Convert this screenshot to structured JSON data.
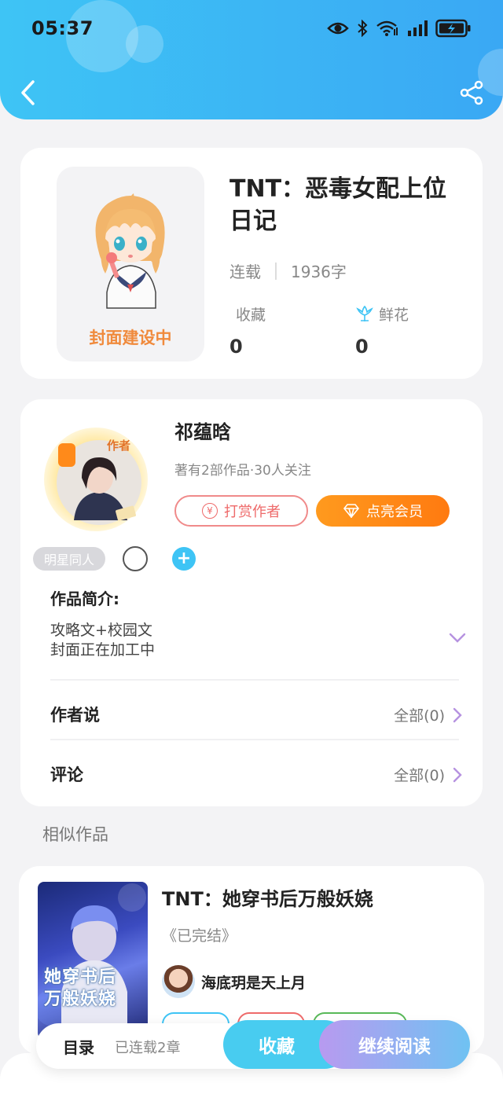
{
  "status_bar": {
    "time": "05:37"
  },
  "book": {
    "title": "TNT：恶毒女配上位日记",
    "cover_caption": "封面建设中",
    "status": "连载",
    "word_count": "1936字",
    "stats": [
      {
        "label": "收藏",
        "value": "0",
        "icon": ""
      },
      {
        "label": "鲜花",
        "value": "0",
        "icon": "flower-icon"
      }
    ]
  },
  "author": {
    "name": "祁蕴晗",
    "stats": "著有2部作品·30人关注",
    "badge": "作者",
    "tip_button": "打赏作者",
    "tip_icon_char": "¥",
    "vip_button": "点亮会员",
    "tag": "明星同人",
    "tag_add": "+"
  },
  "intro": {
    "heading": "作品简介:",
    "lines": [
      "攻略文+校园文",
      "封面正在加工中"
    ]
  },
  "rows": [
    {
      "label": "作者说",
      "more": "全部(0)"
    },
    {
      "label": "评论",
      "more": "全部(0)"
    }
  ],
  "similar": {
    "heading": "相似作品",
    "items": [
      {
        "title": "TNT：她穿书后万般妖娆",
        "status": "《已完结》",
        "author": "海底玥是天上月",
        "cover_text": [
          "她穿书后",
          "万般妖娆"
        ],
        "tag_colors": [
          "#3ec4f5",
          "#ee6a6a",
          "#58b858"
        ]
      }
    ]
  },
  "bottom_bar": {
    "toc": "目录",
    "chapters": "已连载2章",
    "collect": "收藏",
    "read": "继续阅读"
  },
  "colors": {
    "brand": "#3ec4f5",
    "accent_orange": "#ff8a1a",
    "tip_red": "#ee6a6a",
    "read_gradient_start": "#b89af0"
  }
}
